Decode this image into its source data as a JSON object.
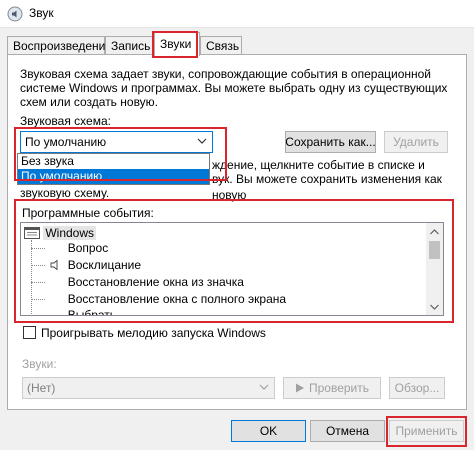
{
  "window": {
    "title": "Звук",
    "icon": "speaker-icon"
  },
  "tabs": [
    {
      "label": "Воспроизведение"
    },
    {
      "label": "Запись"
    },
    {
      "label": "Звуки",
      "active": true
    },
    {
      "label": "Связь"
    }
  ],
  "description": {
    "line1": "Звуковая схема задает звуки, сопровождающие события в операционной",
    "line2": "системе Windows и программах. Вы можете выбрать одну из существующих",
    "line3": "схем или создать новую."
  },
  "scheme": {
    "label": "Звуковая схема:",
    "selected": "По умолчанию",
    "options": [
      "Без звука",
      "По умолчанию"
    ],
    "save_button": "Сохранить как...",
    "delete_button": "Удалить"
  },
  "hint": {
    "line1_tail": "ждение, щелкните событие в списке и",
    "line2_tail": "вук. Вы можете сохранить изменения как новую",
    "line3": "звуковую схему."
  },
  "events": {
    "label": "Программные события:",
    "root": "Windows",
    "items": [
      {
        "label": "Вопрос",
        "has_sound": false
      },
      {
        "label": "Восклицание",
        "has_sound": true
      },
      {
        "label": "Восстановление окна из значка",
        "has_sound": false
      },
      {
        "label": "Восстановление окна с полного экрана",
        "has_sound": false
      },
      {
        "label": "Выбрать",
        "has_sound": false
      }
    ]
  },
  "startup_checkbox": {
    "label": "Проигрывать мелодию запуска Windows",
    "checked": false
  },
  "sounds": {
    "label": "Звуки:",
    "value": "(Нет)",
    "test_button": "Проверить",
    "browse_button": "Обзор..."
  },
  "footer": {
    "ok": "OK",
    "cancel": "Отмена",
    "apply": "Применить"
  },
  "colors": {
    "highlight": "#d9262e",
    "selection": "#0078d7"
  }
}
